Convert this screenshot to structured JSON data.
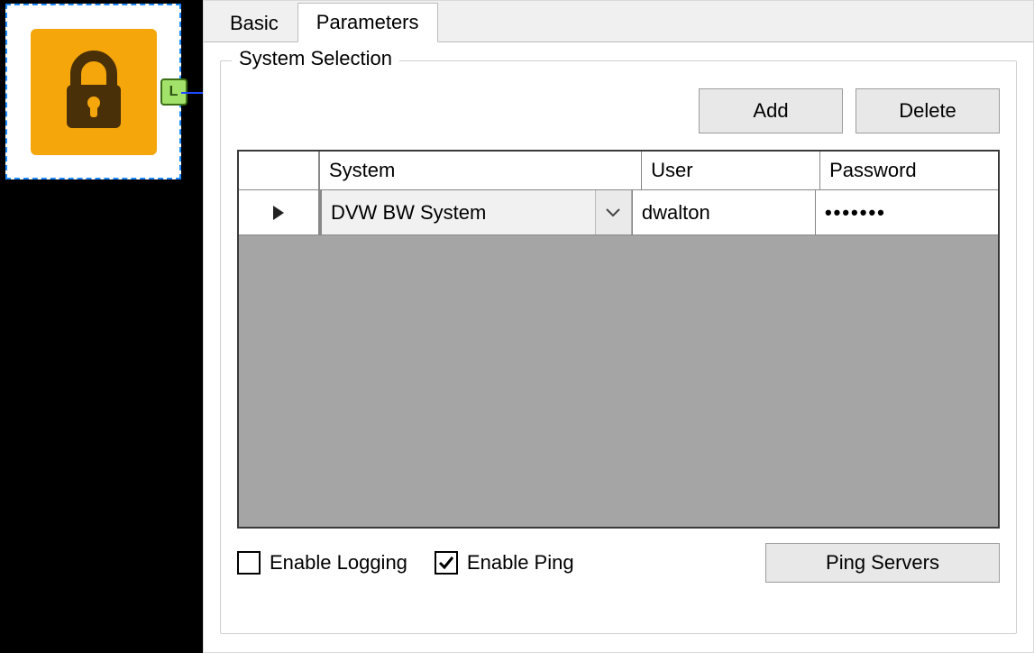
{
  "node": {
    "port_label": "L"
  },
  "tabs": {
    "basic": "Basic",
    "parameters": "Parameters"
  },
  "fieldset": {
    "legend": "System Selection"
  },
  "buttons": {
    "add": "Add",
    "delete": "Delete",
    "ping": "Ping Servers"
  },
  "grid": {
    "headers": {
      "system": "System",
      "user": "User",
      "password": "Password"
    },
    "rows": [
      {
        "system": "DVW BW System",
        "user": "dwalton",
        "password_mask": "•••••••"
      }
    ]
  },
  "checks": {
    "enable_logging": {
      "label": "Enable Logging",
      "checked": false
    },
    "enable_ping": {
      "label": "Enable Ping",
      "checked": true
    }
  }
}
